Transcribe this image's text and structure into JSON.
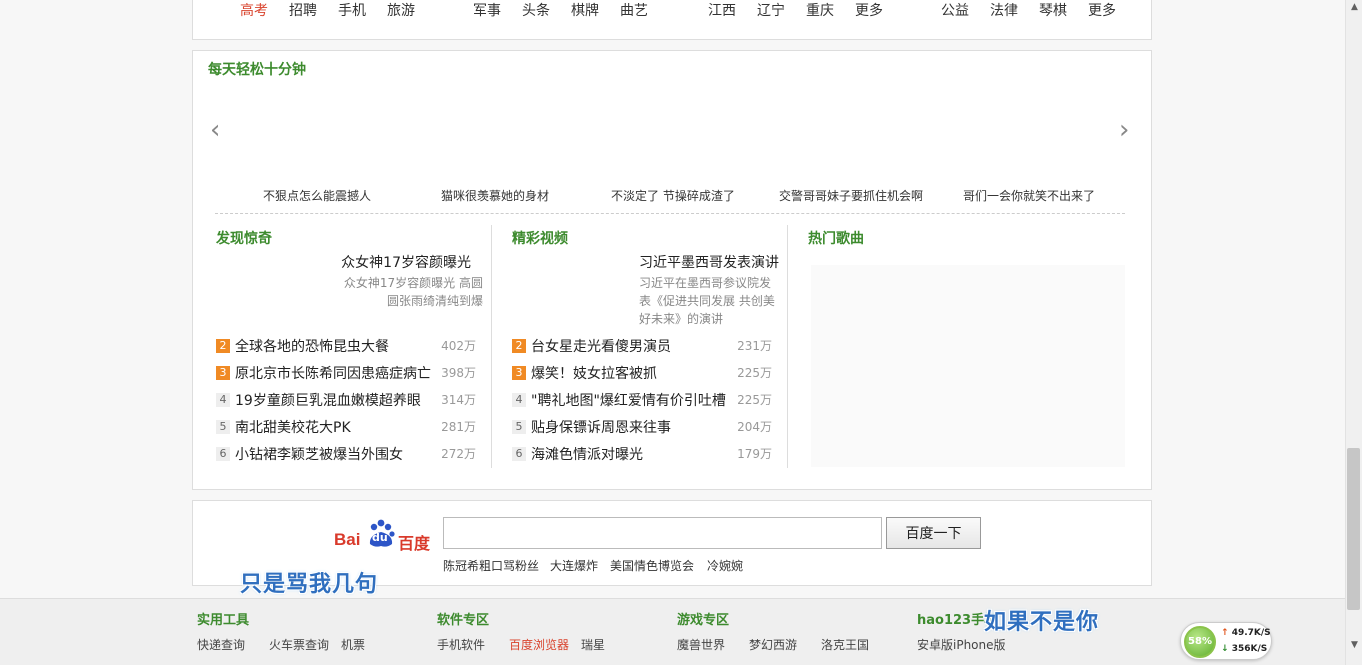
{
  "topnav": {
    "items": [
      "高考",
      "招聘",
      "手机",
      "旅游",
      "军事",
      "头条",
      "棋牌",
      "曲艺",
      "江西",
      "辽宁",
      "重庆",
      "更多",
      "公益",
      "法律",
      "琴棋",
      "更多"
    ]
  },
  "relax": {
    "title": "每天轻松十分钟",
    "prev_arrow": "‹",
    "next_arrow": "›",
    "captions": [
      "不狠点怎么能震撼人",
      "猫咪很羡慕她的身材",
      "不淡定了 节操碎成渣了",
      "交警哥哥妹子要抓住机会啊",
      "哥们一会你就笑不出来了"
    ]
  },
  "discover": {
    "title": "发现惊奇",
    "feature_title": "众女神17岁容颜曝光",
    "feature_desc": "众女神17岁容颜曝光 高圆圆张雨绮清纯到爆",
    "list": [
      {
        "rank": "2",
        "title": "全球各地的恐怖昆虫大餐",
        "count": "402万"
      },
      {
        "rank": "3",
        "title": "原北京市长陈希同因患癌症病亡",
        "count": "398万"
      },
      {
        "rank": "4",
        "title": "19岁童颜巨乳混血嫩模超养眼",
        "count": "314万"
      },
      {
        "rank": "5",
        "title": "南北甜美校花大PK",
        "count": "281万"
      },
      {
        "rank": "6",
        "title": "小钻裙李颖芝被爆当外围女",
        "count": "272万"
      }
    ]
  },
  "videos": {
    "title": "精彩视频",
    "feature_title": "习近平墨西哥发表演讲",
    "feature_desc": "习近平在墨西哥参议院发表《促进共同发展 共创美好未来》的演讲",
    "list": [
      {
        "rank": "2",
        "title": "台女星走光看傻男演员",
        "count": "231万"
      },
      {
        "rank": "3",
        "title": "爆笑！妓女拉客被抓",
        "count": "225万"
      },
      {
        "rank": "4",
        "title": "\"聘礼地图\"爆红爱情有价引吐槽",
        "count": "225万"
      },
      {
        "rank": "5",
        "title": "贴身保镖诉周恩来往事",
        "count": "204万"
      },
      {
        "rank": "6",
        "title": "海滩色情派对曝光",
        "count": "179万"
      }
    ]
  },
  "songs": {
    "title": "热门歌曲"
  },
  "search": {
    "logo_bai": "Bai",
    "logo_du": "du",
    "logo_cn": "百度",
    "input_value": "",
    "button_label": "百度一下",
    "hotwords": [
      "陈冠希粗口骂粉丝",
      "大连爆炸",
      "美国情色博览会",
      "冷婉婉"
    ]
  },
  "lyrics": {
    "left": "只是骂我几句",
    "right": "如果不是你"
  },
  "footer": {
    "columns": [
      {
        "title": "实用工具",
        "links": [
          "快递查询",
          "火车票查询",
          "机票"
        ]
      },
      {
        "title": "软件专区",
        "links": [
          "手机软件",
          "百度浏览器",
          "瑞星"
        ]
      },
      {
        "title": "游戏专区",
        "links": [
          "魔兽世界",
          "梦幻西游",
          "洛克王国"
        ]
      },
      {
        "title": "hao123手机",
        "links": [
          "安卓版iPhone版"
        ]
      }
    ]
  },
  "speed": {
    "percent": "58%",
    "up": "49.7K/S",
    "down": "356K/S"
  },
  "colors": {
    "accent_green": "#3d8b2e",
    "accent_red": "#d9442e",
    "hot_rank": "#f08a24",
    "lyric_blue": "#2f6fbf"
  }
}
